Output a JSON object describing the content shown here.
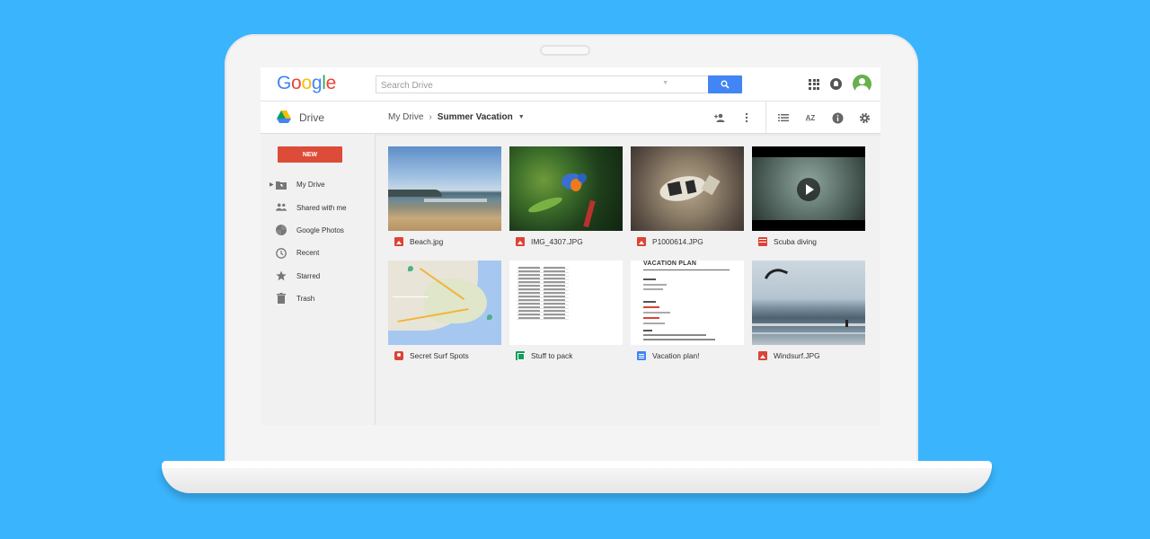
{
  "header": {
    "logo_letters": [
      {
        "ch": "G",
        "color": "#4285f4"
      },
      {
        "ch": "o",
        "color": "#ea4335"
      },
      {
        "ch": "o",
        "color": "#fbbc05"
      },
      {
        "ch": "g",
        "color": "#4285f4"
      },
      {
        "ch": "l",
        "color": "#34a853"
      },
      {
        "ch": "e",
        "color": "#ea4335"
      }
    ],
    "search_placeholder": "Search Drive"
  },
  "subbar": {
    "app_name": "Drive",
    "breadcrumb_root": "My Drive",
    "breadcrumb_current": "Summer Vacation"
  },
  "sidebar": {
    "new_label": "NEW",
    "items": [
      {
        "label": "My Drive",
        "icon": "folder-drive-icon"
      },
      {
        "label": "Shared with me",
        "icon": "people-icon"
      },
      {
        "label": "Google Photos",
        "icon": "photos-icon"
      },
      {
        "label": "Recent",
        "icon": "clock-icon"
      },
      {
        "label": "Starred",
        "icon": "star-icon"
      },
      {
        "label": "Trash",
        "icon": "trash-icon"
      }
    ]
  },
  "files": [
    {
      "name": "Beach.jpg",
      "type": "image"
    },
    {
      "name": "IMG_4307.JPG",
      "type": "image"
    },
    {
      "name": "P1000614.JPG",
      "type": "image"
    },
    {
      "name": "Scuba diving",
      "type": "video"
    },
    {
      "name": "Secret Surf Spots",
      "type": "map"
    },
    {
      "name": "Stuff to pack",
      "type": "sheet"
    },
    {
      "name": "Vacation plan!",
      "type": "doc"
    },
    {
      "name": "Windsurf.JPG",
      "type": "image"
    }
  ],
  "doc_preview_title": "VACATION PLAN",
  "colors": {
    "background": "#3ab4fc",
    "new_button": "#dd4b39",
    "search_button": "#4285f4"
  }
}
